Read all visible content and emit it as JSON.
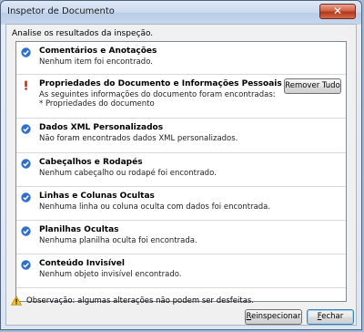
{
  "window": {
    "title": "Inspetor de Documento",
    "close_glyph": "✕",
    "instruction": "Analise os resultados da inspeção."
  },
  "results": [
    {
      "icon": "check-icon",
      "status": "ok",
      "title": "Comentários e Anotações",
      "desc": "Nenhum item foi encontrado."
    },
    {
      "icon": "warning-exclamation-icon",
      "status": "found",
      "title": "Propriedades do Documento e Informações Pessoais",
      "desc": "As seguintes informações do documento foram encontradas:",
      "desc2": "* Propriedades do documento",
      "button": "Remover Tudo"
    },
    {
      "icon": "check-icon",
      "status": "ok",
      "title": "Dados XML Personalizados",
      "desc": "Não foram encontrados dados XML personalizados."
    },
    {
      "icon": "check-icon",
      "status": "ok",
      "title": "Cabeçalhos e Rodapés",
      "desc": "Nenhum cabeçalho ou rodapé foi encontrado."
    },
    {
      "icon": "check-icon",
      "status": "ok",
      "title": "Linhas e Colunas Ocultas",
      "desc": "Nenhuma linha ou coluna oculta com dados foi encontrada."
    },
    {
      "icon": "check-icon",
      "status": "ok",
      "title": "Planilhas Ocultas",
      "desc": "Nenhuma planilha oculta foi encontrada."
    },
    {
      "icon": "check-icon",
      "status": "ok",
      "title": "Conteúdo Invisível",
      "desc": "Nenhum objeto invisível encontrado."
    }
  ],
  "footer": {
    "warning": "Observação: algumas alterações não podem ser desfeitas.",
    "reinspect_label": "Reinspecionar",
    "reinspect_mnemonic": "R",
    "reinspect_rest": "einspecionar",
    "close_label": "Fechar",
    "close_mnemonic": "F",
    "close_rest": "echar"
  },
  "colors": {
    "check_blue": "#2f6fc9",
    "warn_red": "#d3261b",
    "warn_triangle": "#f2c21b"
  }
}
